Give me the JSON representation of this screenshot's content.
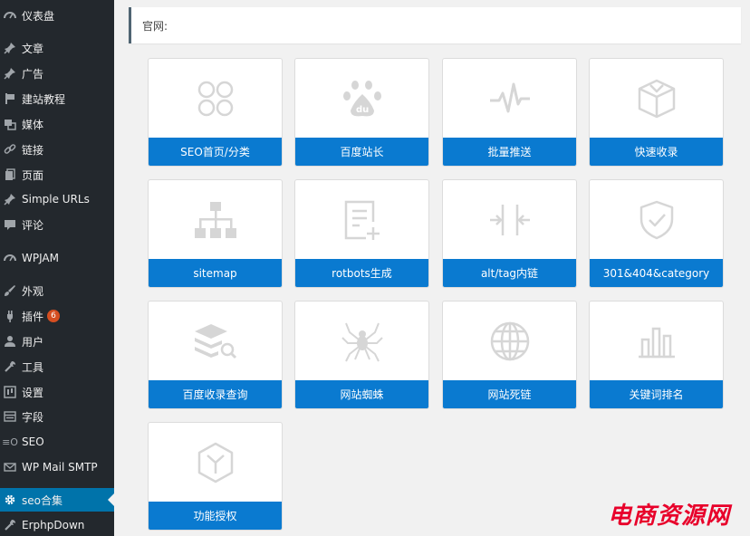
{
  "sidebar": {
    "items": [
      {
        "label": "仪表盘",
        "icon": "dashboard-icon"
      },
      {
        "label": "文章",
        "icon": "pin-icon"
      },
      {
        "label": "广告",
        "icon": "pin-icon"
      },
      {
        "label": "建站教程",
        "icon": "flag-icon"
      },
      {
        "label": "媒体",
        "icon": "media-icon"
      },
      {
        "label": "链接",
        "icon": "link-icon"
      },
      {
        "label": "页面",
        "icon": "page-icon"
      },
      {
        "label": "Simple URLs",
        "icon": "pin-icon"
      },
      {
        "label": "评论",
        "icon": "comment-icon"
      },
      {
        "label": "WPJAM",
        "icon": "dashboard-icon"
      },
      {
        "label": "外观",
        "icon": "brush-icon"
      },
      {
        "label": "插件",
        "icon": "plugin-icon",
        "badge": "6"
      },
      {
        "label": "用户",
        "icon": "user-icon"
      },
      {
        "label": "工具",
        "icon": "wrench-icon"
      },
      {
        "label": "设置",
        "icon": "settings-icon"
      },
      {
        "label": "字段",
        "icon": "fields-icon"
      },
      {
        "label": "SEO",
        "icon": "seo-icon"
      },
      {
        "label": "WP Mail SMTP",
        "icon": "mail-icon"
      },
      {
        "label": "seo合集",
        "icon": "gear-icon",
        "active": true
      },
      {
        "label": "ErphpDown",
        "icon": "wrench-icon"
      }
    ]
  },
  "notice": {
    "text": "官网:"
  },
  "cards": [
    {
      "label": "SEO首页/分类",
      "icon": "four-circles-icon"
    },
    {
      "label": "百度站长",
      "icon": "baidu-paw-icon"
    },
    {
      "label": "批量推送",
      "icon": "pulse-icon"
    },
    {
      "label": "快速收录",
      "icon": "box-icon"
    },
    {
      "label": "sitemap",
      "icon": "sitemap-icon"
    },
    {
      "label": "rotbots生成",
      "icon": "file-add-icon"
    },
    {
      "label": "alt/tag内链",
      "icon": "split-arrows-icon"
    },
    {
      "label": "301&404&category",
      "icon": "shield-check-icon"
    },
    {
      "label": "百度收录查询",
      "icon": "layers-search-icon"
    },
    {
      "label": "网站蜘蛛",
      "icon": "spider-icon"
    },
    {
      "label": "网站死链",
      "icon": "globe-icon"
    },
    {
      "label": "关键词排名",
      "icon": "bar-chart-icon"
    },
    {
      "label": "功能授权",
      "icon": "hexagon-y-icon"
    }
  ],
  "watermark": {
    "text": "电商资源网"
  },
  "colors": {
    "sidebar_bg": "#23282d",
    "active_bg": "#0073aa",
    "card_label_bg": "#0a7ad0",
    "watermark": "#e8002a",
    "badge": "#d54e21"
  }
}
